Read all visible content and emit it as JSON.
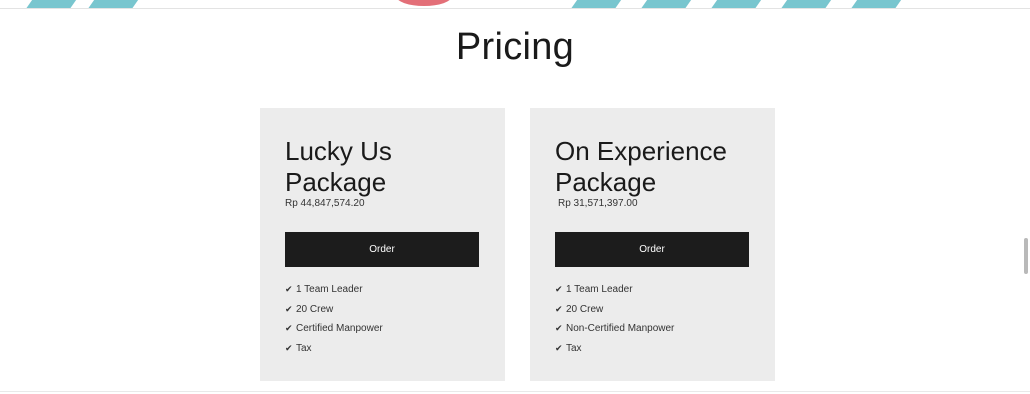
{
  "section": {
    "title": "Pricing"
  },
  "cards": [
    {
      "name_line1": "Lucky Us",
      "name_line2": "Package",
      "price": "Rp 44,847,574.20",
      "order_label": "Order",
      "features": [
        "1 Team Leader",
        "20 Crew",
        "Certified Manpower",
        "Tax"
      ]
    },
    {
      "name_line1": "On Experience",
      "name_line2": "Package",
      "price": "Rp 31,571,397.00",
      "order_label": "Order",
      "features": [
        "1 Team Leader",
        "20 Crew",
        "Non-Certified Manpower",
        "Tax"
      ]
    }
  ],
  "icons": {
    "check": "check-icon"
  },
  "colors": {
    "card_background": "#ececec",
    "button_background": "#1c1c1c",
    "button_text": "#ffffff",
    "decor_teal": "#79c6cf",
    "decor_red": "#e36f78"
  }
}
